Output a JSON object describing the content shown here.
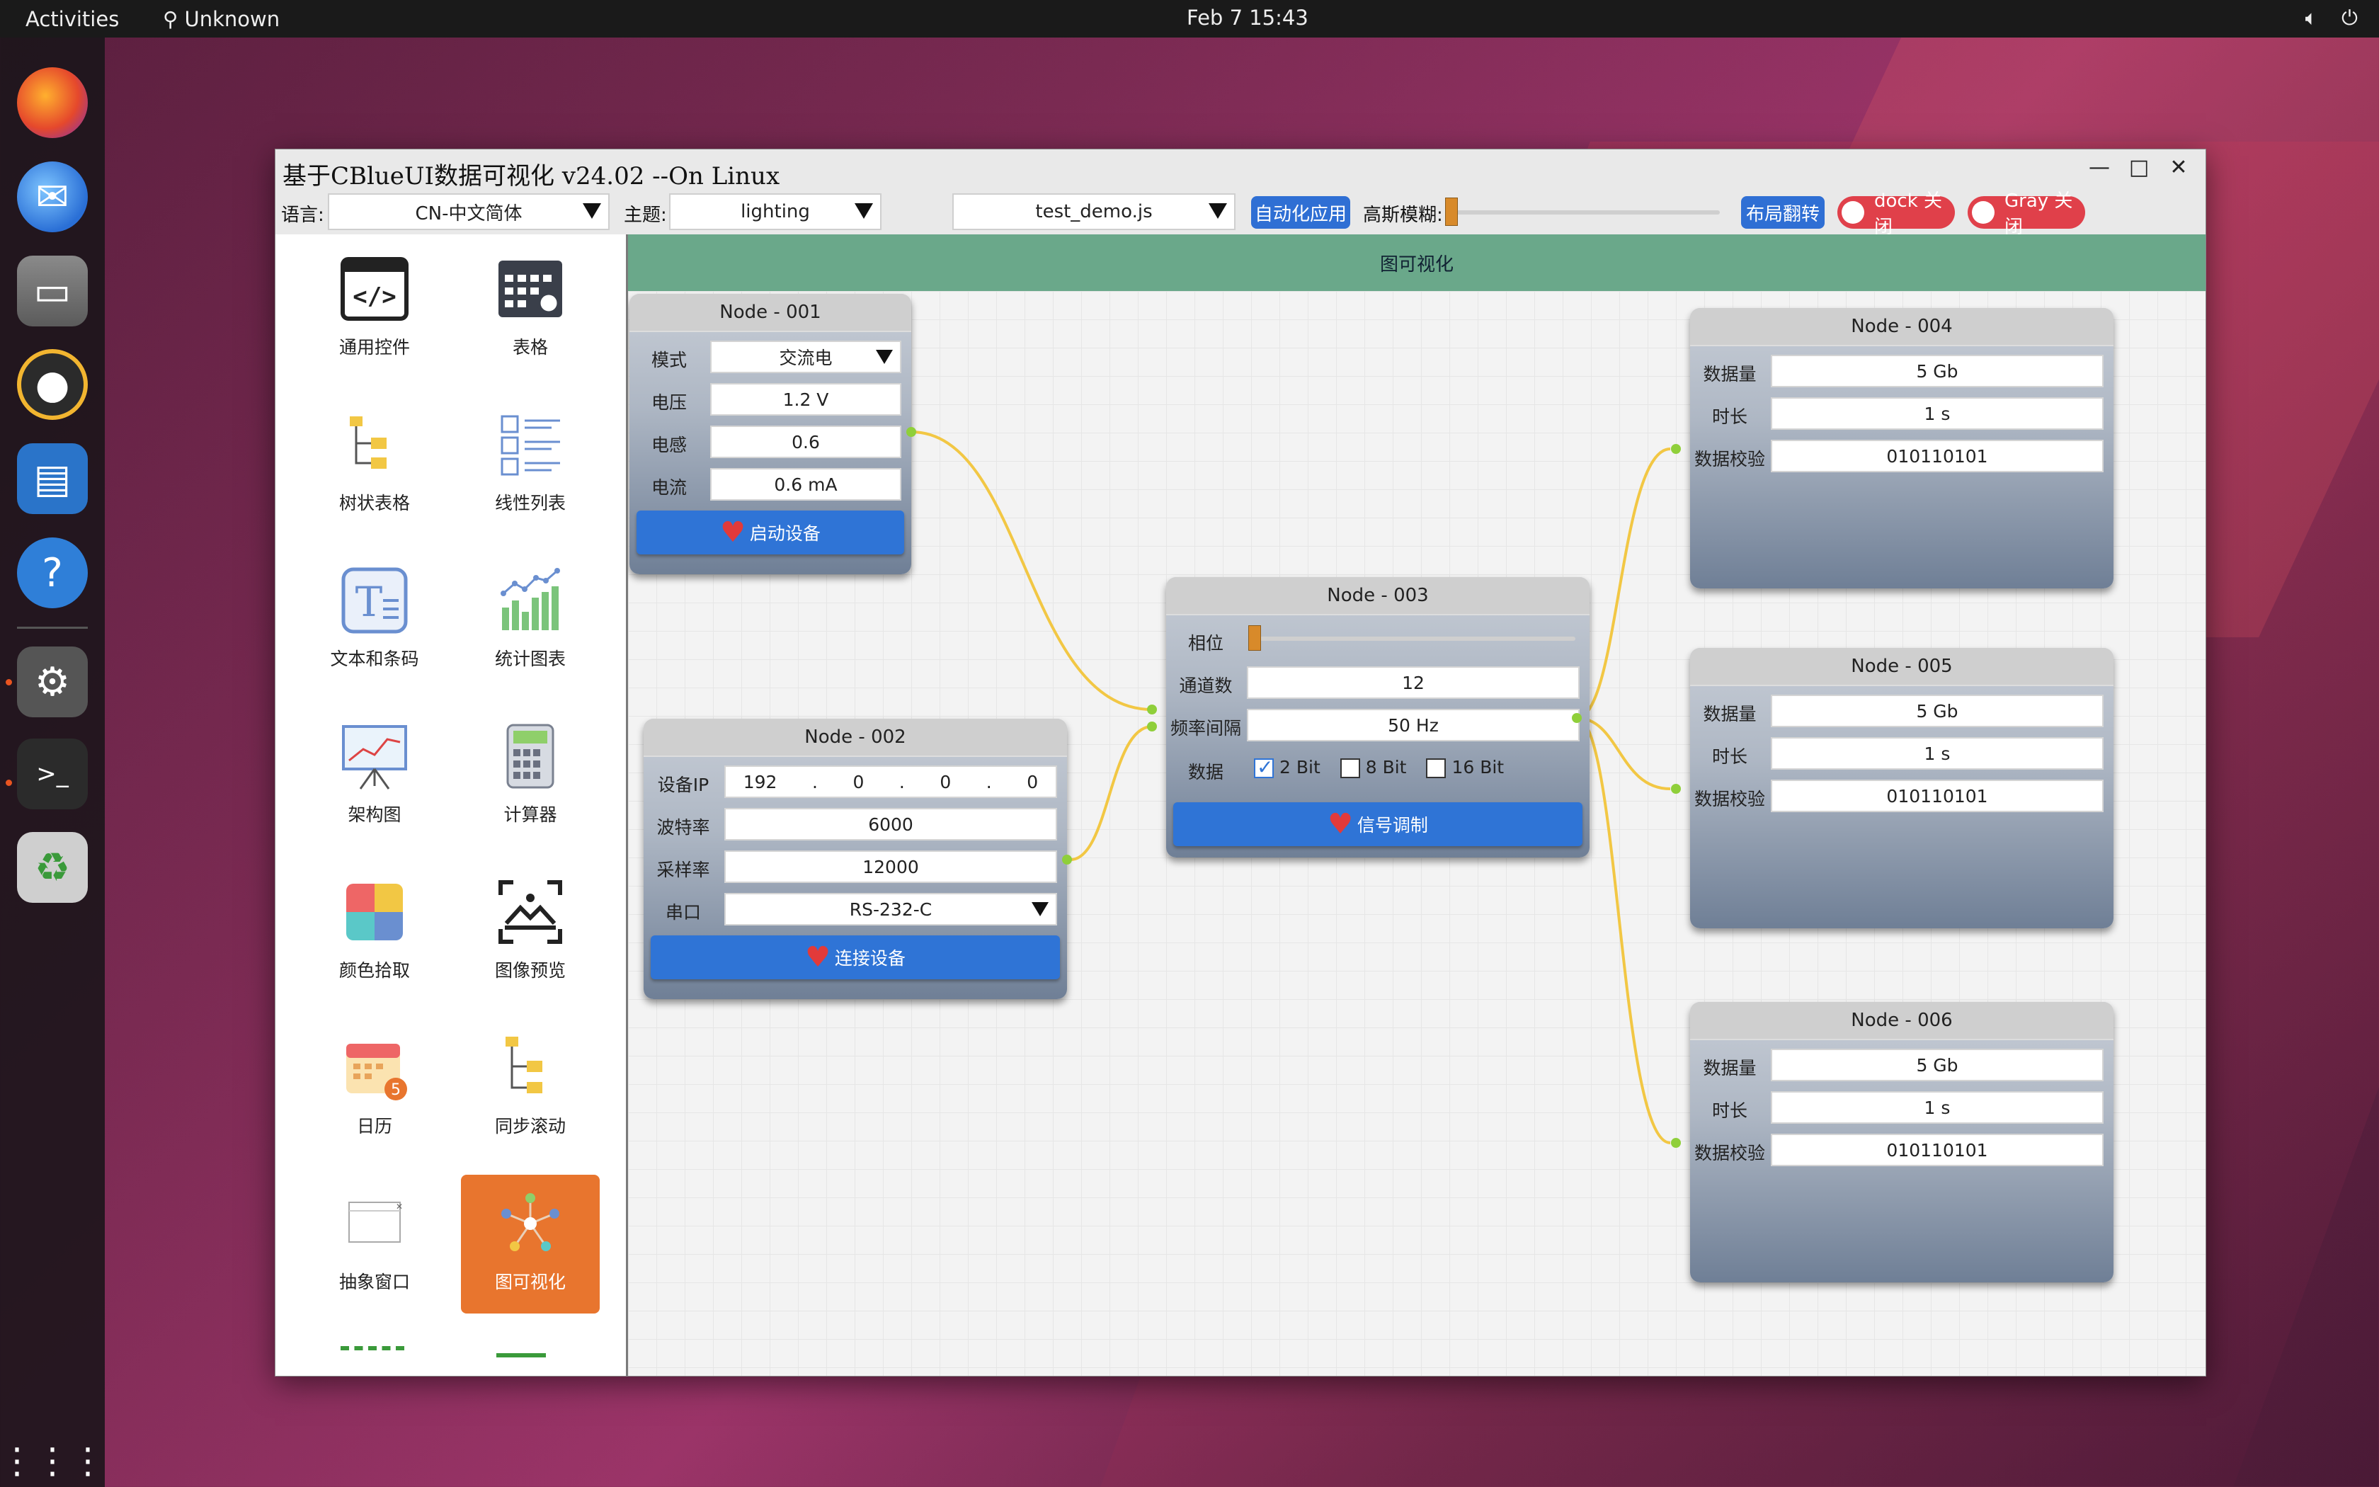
{
  "topbar": {
    "activities": "Activities",
    "app_indicator": "Unknown",
    "clock": "Feb 7  15:43",
    "volume_icon": "volume-icon",
    "power_icon": "power-icon"
  },
  "dock": {
    "items": [
      "firefox-icon",
      "thunderbird-icon",
      "files-icon",
      "rhythmbox-icon",
      "writer-icon",
      "help-icon",
      "settings-icon",
      "terminal-icon",
      "trash-icon",
      "app-grid-icon"
    ]
  },
  "window": {
    "title": "基于CBlueUI数据可视化 v24.02 --On Linux",
    "controls": {
      "minimize": "—",
      "maximize": "□",
      "close": "✕"
    }
  },
  "toolbar": {
    "lang_label": "语言:",
    "lang_value": "CN-中文简体",
    "theme_label": "主题:",
    "theme_value": "lighting",
    "script_value": "test_demo.js",
    "auto_apply": "自动化应用",
    "blur_label": "高斯模糊:",
    "blur_level": 0,
    "layout_flip": "布局翻转",
    "dock_toggle": "dock 关闭",
    "gray_toggle": "Gray 关闭"
  },
  "sidebar": {
    "items": [
      {
        "label": "通用控件",
        "icon": "code-window-icon"
      },
      {
        "label": "表格",
        "icon": "table-settings-icon"
      },
      {
        "label": "树状表格",
        "icon": "tree-table-icon"
      },
      {
        "label": "线性列表",
        "icon": "linear-list-icon"
      },
      {
        "label": "文本和条码",
        "icon": "text-icon"
      },
      {
        "label": "统计图表",
        "icon": "stat-chart-icon"
      },
      {
        "label": "架构图",
        "icon": "whiteboard-icon"
      },
      {
        "label": "计算器",
        "icon": "calculator-icon"
      },
      {
        "label": "颜色拾取",
        "icon": "color-picker-icon"
      },
      {
        "label": "图像预览",
        "icon": "image-preview-icon"
      },
      {
        "label": "日历",
        "icon": "calendar-icon"
      },
      {
        "label": "同步滚动",
        "icon": "sync-scroll-icon"
      },
      {
        "label": "抽象窗口",
        "icon": "abstract-window-icon"
      },
      {
        "label": "图可视化",
        "icon": "graph-icon",
        "active": true
      }
    ]
  },
  "canvas": {
    "header": "图可视化",
    "node1": {
      "title": "Node - 001",
      "mode_label": "模式",
      "mode_value": "交流电",
      "voltage_label": "电压",
      "voltage_value": "1.2 V",
      "inductance_label": "电感",
      "inductance_value": "0.6",
      "current_label": "电流",
      "current_value": "0.6 mA",
      "button": "启动设备"
    },
    "node2": {
      "title": "Node - 002",
      "ip_label": "设备IP",
      "ip": [
        "192",
        "0",
        "0",
        "0"
      ],
      "ip_dot": ".",
      "baud_label": "波特率",
      "baud_value": "6000",
      "sample_label": "采样率",
      "sample_value": "12000",
      "port_label": "串口",
      "port_value": "RS-232-C",
      "button": "连接设备"
    },
    "node3": {
      "title": "Node - 003",
      "phase_label": "相位",
      "phase_level": 0,
      "channels_label": "通道数",
      "channels_value": "12",
      "freq_label": "频率间隔",
      "freq_value": "50 Hz",
      "data_label": "数据",
      "opt1": "2 Bit",
      "opt1_checked": true,
      "opt2": "8 Bit",
      "opt3": "16 Bit",
      "button": "信号调制"
    },
    "node4": {
      "title": "Node - 004",
      "amount_label": "数据量",
      "amount_value": "5 Gb",
      "duration_label": "时长",
      "duration_value": "1 s",
      "check_label": "数据校验",
      "check_value": "010110101"
    },
    "node5": {
      "title": "Node - 005",
      "amount_label": "数据量",
      "amount_value": "5 Gb",
      "duration_label": "时长",
      "duration_value": "1 s",
      "check_label": "数据校验",
      "check_value": "010110101"
    },
    "node6": {
      "title": "Node - 006",
      "amount_label": "数据量",
      "amount_value": "5 Gb",
      "duration_label": "时长",
      "duration_value": "1 s",
      "check_label": "数据校验",
      "check_value": "010110101"
    }
  },
  "colors": {
    "accent_blue": "#2f74d6",
    "active_orange": "#e8752e",
    "toggle_red": "#e0404a",
    "header_green": "#6aa88a",
    "wire_yellow": "#f2c744"
  }
}
